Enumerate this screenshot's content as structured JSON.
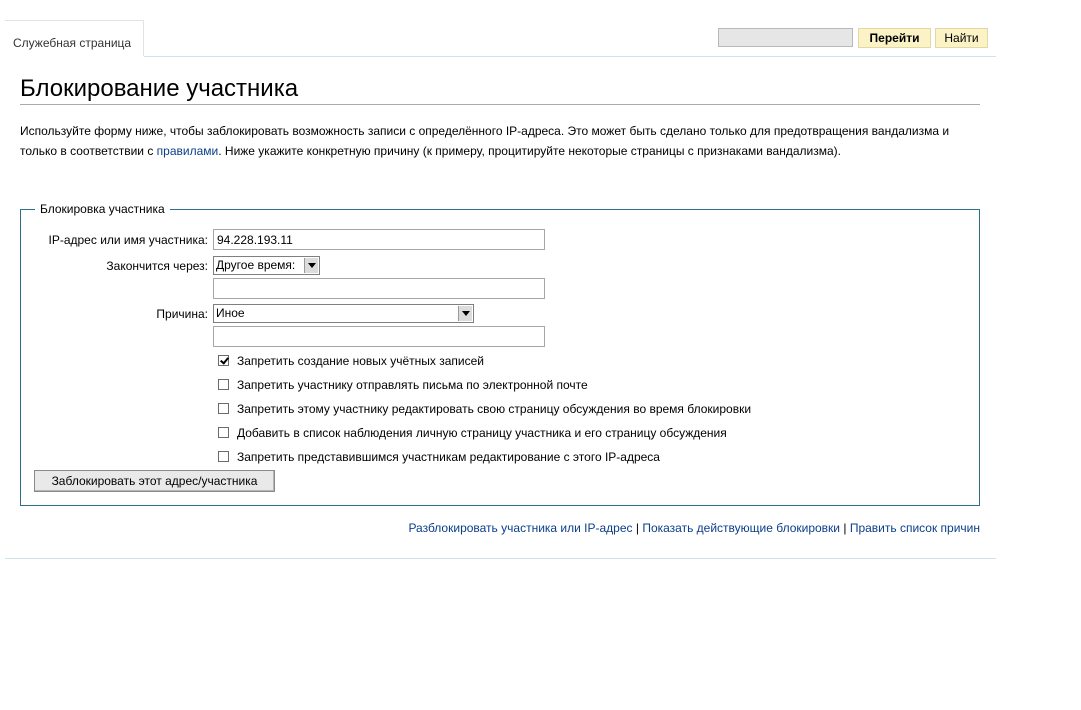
{
  "header": {
    "tab_label": "Служебная страница",
    "search_value": "",
    "go_label": "Перейти",
    "find_label": "Найти"
  },
  "page": {
    "title": "Блокирование участника",
    "intro_part1": "Используйте форму ниже, чтобы заблокировать возможность записи с определённого IP-адреса. Это может быть сделано только для предотвращения вандализма и только в соответствии с ",
    "intro_link": "правилами",
    "intro_part2": ". Ниже укажите конкретную причину (к примеру, процитируйте некоторые страницы с признаками вандализма)."
  },
  "form": {
    "legend": "Блокировка участника",
    "target_label": "IP-адрес или имя участника:",
    "target_value": "94.228.193.11",
    "expiry_label": "Закончится через:",
    "expiry_selected": "Другое время:",
    "expiry_other_value": "",
    "reason_label": "Причина:",
    "reason_selected": "Иное",
    "reason_other_value": "",
    "checkboxes": [
      {
        "label": "Запретить создание новых учётных записей",
        "checked": true
      },
      {
        "label": "Запретить участнику отправлять письма по электронной почте",
        "checked": false
      },
      {
        "label": "Запретить этому участнику редактировать свою страницу обсуждения во время блокировки",
        "checked": false
      },
      {
        "label": "Добавить в список наблюдения личную страницу участника и его страницу обсуждения",
        "checked": false
      },
      {
        "label": "Запретить представившимся участникам редактирование с этого IP-адреса",
        "checked": false
      }
    ],
    "submit_label": "Заблокировать этот адрес/участника"
  },
  "links": {
    "unblock": "Разблокировать участника или IP-адрес",
    "separator": " | ",
    "show_blocks": "Показать действующие блокировки",
    "edit_reasons": "Править список причин"
  },
  "colors": {
    "link": "#0b3e8a",
    "fieldset_border": "#2d6f88",
    "top_button_bg": "#fbf3c6"
  }
}
